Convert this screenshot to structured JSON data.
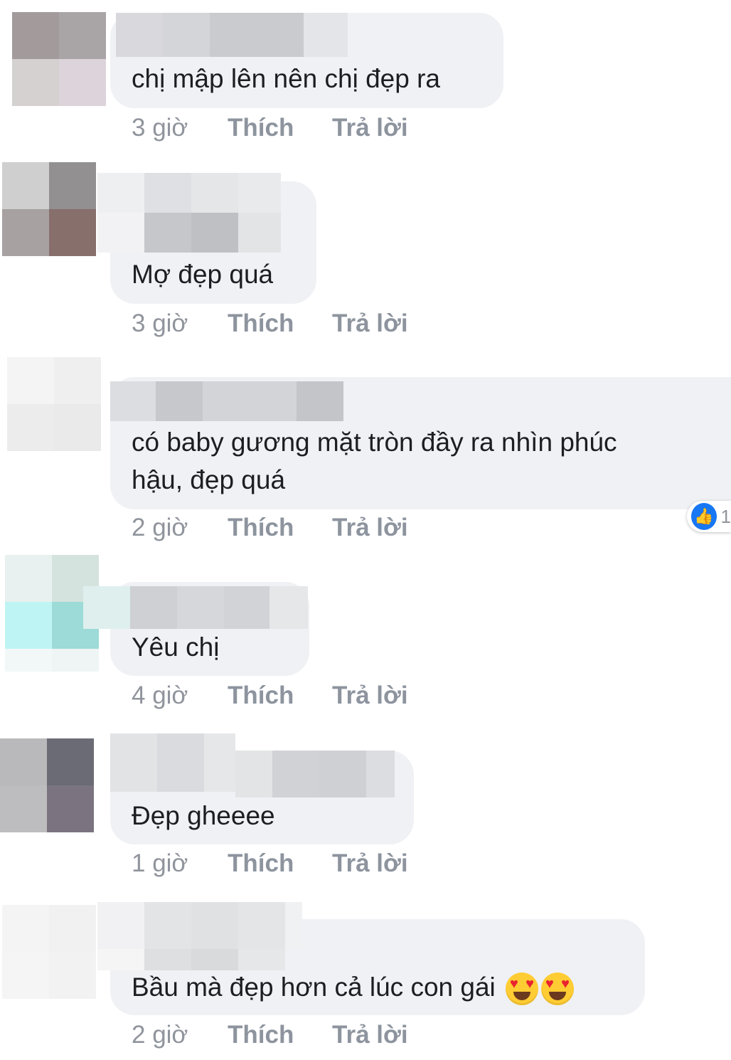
{
  "actions": {
    "like_label": "Thích",
    "reply_label": "Trả lời"
  },
  "comments": [
    {
      "text_lines": [
        "chị mập lên nên chị đẹp ra"
      ],
      "time": "3 giờ"
    },
    {
      "text_lines": [
        "Mợ đẹp quá"
      ],
      "time": "3 giờ"
    },
    {
      "text_lines": [
        "có baby gương mặt tròn đầy ra nhìn phúc",
        "hậu, đẹp quá"
      ],
      "time": "2 giờ",
      "reaction": {
        "icon": "thumbs-up-icon",
        "count": "1"
      }
    },
    {
      "text_lines": [
        "Yêu chị"
      ],
      "time": "4 giờ"
    },
    {
      "text_lines": [
        "Đẹp gheeee"
      ],
      "time": "1 giờ"
    },
    {
      "text_lines": [
        "Bầu mà đẹp hơn cả lúc con gái"
      ],
      "time": "2 giờ",
      "emoji": [
        "heart-eyes-emoji",
        "heart-eyes-emoji"
      ]
    }
  ],
  "colors": {
    "bubble": "#f0f1f4",
    "action_text": "#8d949e",
    "like_blue": "#1877f2"
  }
}
